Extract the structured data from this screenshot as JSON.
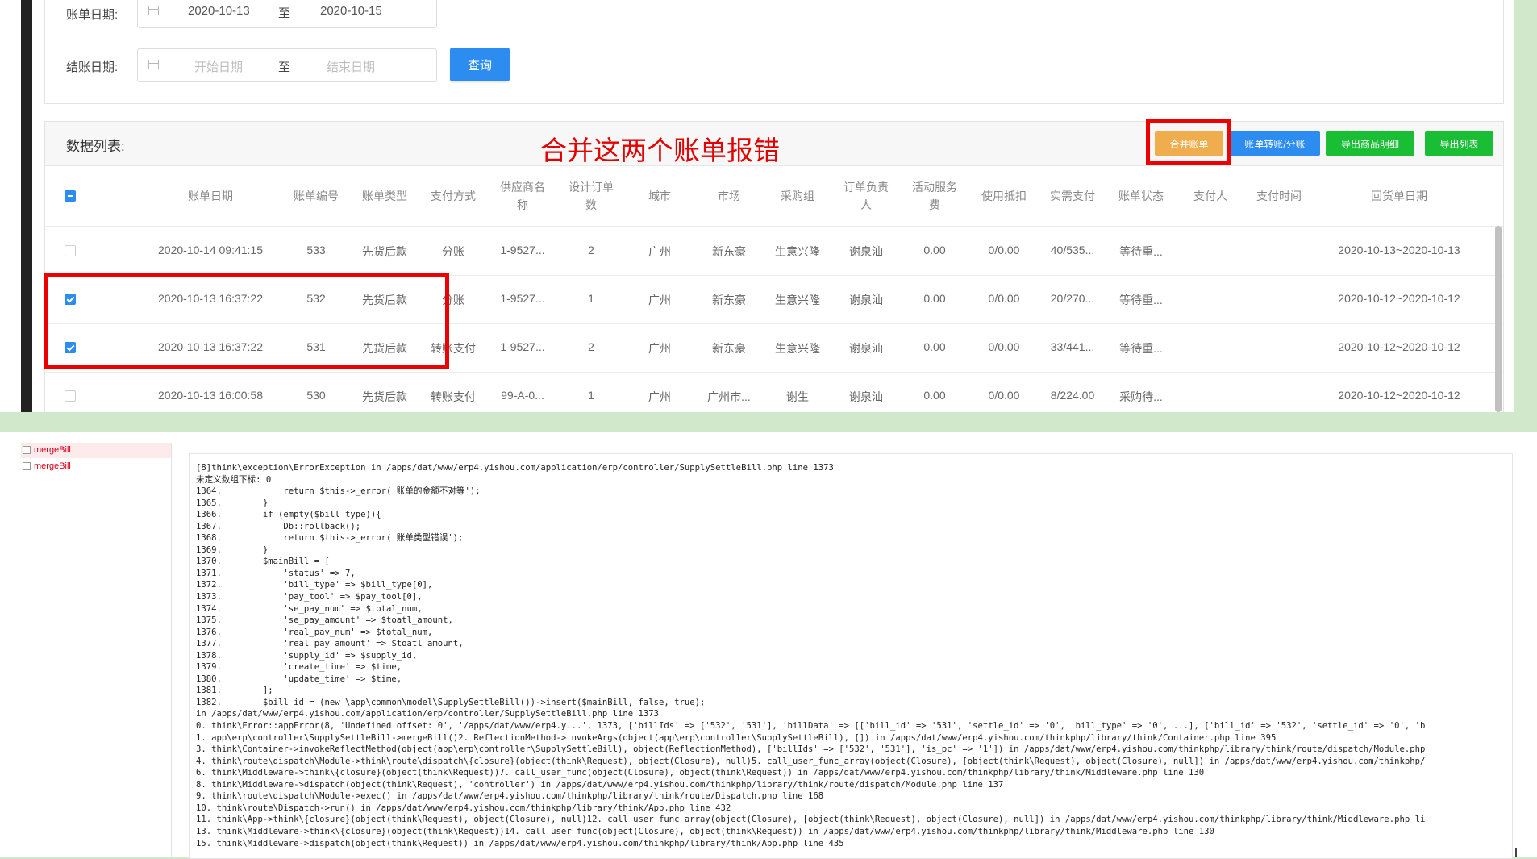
{
  "filters": {
    "bill_date_label": "账单日期:",
    "bill_date_start": "2020-10-13",
    "bill_date_end": "2020-10-15",
    "settle_date_label": "结账日期:",
    "settle_start_placeholder": "开始日期",
    "settle_end_placeholder": "结束日期",
    "range_separator": "至",
    "query_button": "查询"
  },
  "list": {
    "title": "数据列表:",
    "annotation": "合并这两个账单报错",
    "buttons": {
      "merge": "合并账单",
      "transfer": "账单转账/分账",
      "export_detail": "导出商品明细",
      "export_list": "导出列表"
    }
  },
  "table": {
    "columns": [
      [
        "账单日期"
      ],
      [
        "账单编号"
      ],
      [
        "账单类型"
      ],
      [
        "支付方式"
      ],
      [
        "供应商名",
        "称"
      ],
      [
        "设计订单",
        "数"
      ],
      [
        "城市"
      ],
      [
        "市场"
      ],
      [
        "采购组"
      ],
      [
        "订单负责",
        "人"
      ],
      [
        "活动服务",
        "费"
      ],
      [
        "使用抵扣"
      ],
      [
        "实需支付"
      ],
      [
        "账单状态"
      ],
      [
        "支付人"
      ],
      [
        "支付时间"
      ],
      [
        "回货单日期"
      ]
    ],
    "rows": [
      {
        "checked": false,
        "cells": [
          "2020-10-14 09:41:15",
          "533",
          "先货后款",
          "分账",
          "1-9527...",
          "2",
          "广州",
          "新东豪",
          "生意兴隆",
          "谢泉汕",
          "0.00",
          "0/0.00",
          "40/535...",
          "等待重...",
          "",
          "",
          "2020-10-13~2020-10-13"
        ]
      },
      {
        "checked": true,
        "cells": [
          "2020-10-13 16:37:22",
          "532",
          "先货后款",
          "分账",
          "1-9527...",
          "1",
          "广州",
          "新东豪",
          "生意兴隆",
          "谢泉汕",
          "0.00",
          "0/0.00",
          "20/270...",
          "等待重...",
          "",
          "",
          "2020-10-12~2020-10-12"
        ]
      },
      {
        "checked": true,
        "cells": [
          "2020-10-13 16:37:22",
          "531",
          "先货后款",
          "转账支付",
          "1-9527...",
          "2",
          "广州",
          "新东豪",
          "生意兴隆",
          "谢泉汕",
          "0.00",
          "0/0.00",
          "33/441...",
          "等待重...",
          "",
          "",
          "2020-10-12~2020-10-12"
        ]
      },
      {
        "checked": false,
        "cells": [
          "2020-10-13 16:00:58",
          "530",
          "先货后款",
          "转账支付",
          "99-A-0...",
          "1",
          "广州",
          "广州市...",
          "谢生",
          "谢泉汕",
          "0.00",
          "0/0.00",
          "8/224.00",
          "采购待...",
          "",
          "",
          "2020-10-12~2020-10-12"
        ]
      }
    ]
  },
  "debug": {
    "sidebar_items": [
      "mergeBill",
      "mergeBill"
    ],
    "error_lines": [
      "[8]think\\exception\\ErrorException in /apps/dat/www/erp4.yishou.com/application/erp/controller/SupplySettleBill.php line 1373",
      "未定义数组下标: 0",
      "1364.            return $this->_error('账单的金额不对等');",
      "1365.        }",
      "1366.        if (empty($bill_type)){",
      "1367.            Db::rollback();",
      "1368.            return $this->_error('账单类型错误');",
      "1369.        }",
      "1370.        $mainBill = [",
      "1371.            'status' => 7,",
      "1372.            'bill_type' => $bill_type[0],",
      "1373.            'pay_tool' => $pay_tool[0],",
      "1374.            'se_pay_num' => $total_num,",
      "1375.            'se_pay_amount' => $toatl_amount,",
      "1376.            'real_pay_num' => $total_num,",
      "1377.            'real_pay_amount' => $toatl_amount,",
      "1378.            'supply_id' => $supply_id,",
      "1379.            'create_time' => $time,",
      "1380.            'update_time' => $time,",
      "1381.        ];",
      "1382.        $bill_id = (new \\app\\common\\model\\SupplySettleBill())->insert($mainBill, false, true);",
      "in /apps/dat/www/erp4.yishou.com/application/erp/controller/SupplySettleBill.php line 1373",
      "0. think\\Error::appError(8, 'Undefined offset: 0', '/apps/dat/www/erp4.y...', 1373, ['billIds' => ['532', '531'], 'billData' => [['bill_id' => '531', 'settle_id' => '0', 'bill_type' => '0', ...], ['bill_id' => '532', 'settle_id' => '0', 'b",
      "1. app\\erp\\controller\\SupplySettleBill->mergeBill()2. ReflectionMethod->invokeArgs(object(app\\erp\\controller\\SupplySettleBill), []) in /apps/dat/www/erp4.yishou.com/thinkphp/library/think/Container.php line 395",
      "3. think\\Container->invokeReflectMethod(object(app\\erp\\controller\\SupplySettleBill), object(ReflectionMethod), ['billIds' => ['532', '531'], 'is_pc' => '1']) in /apps/dat/www/erp4.yishou.com/thinkphp/library/think/route/dispatch/Module.php",
      "4. think\\route\\dispatch\\Module->think\\route\\dispatch\\{closure}(object(think\\Request), object(Closure), null)5. call_user_func_array(object(Closure), [object(think\\Request), object(Closure), null]) in /apps/dat/www/erp4.yishou.com/thinkphp/",
      "6. think\\Middleware->think\\{closure}(object(think\\Request))7. call_user_func(object(Closure), object(think\\Request)) in /apps/dat/www/erp4.yishou.com/thinkphp/library/think/Middleware.php line 130",
      "8. think\\Middleware->dispatch(object(think\\Request), 'controller') in /apps/dat/www/erp4.yishou.com/thinkphp/library/think/route/dispatch/Module.php line 137",
      "9. think\\route\\dispatch\\Module->exec() in /apps/dat/www/erp4.yishou.com/thinkphp/library/think/route/Dispatch.php line 168",
      "10. think\\route\\Dispatch->run() in /apps/dat/www/erp4.yishou.com/thinkphp/library/think/App.php line 432",
      "11. think\\App->think\\{closure}(object(think\\Request), object(Closure), null)12. call_user_func_array(object(Closure), [object(think\\Request), object(Closure), null]) in /apps/dat/www/erp4.yishou.com/thinkphp/library/think/Middleware.php li",
      "13. think\\Middleware->think\\{closure}(object(think\\Request))14. call_user_func(object(Closure), object(think\\Request)) in /apps/dat/www/erp4.yishou.com/thinkphp/library/think/Middleware.php line 130",
      "15. think\\Middleware->dispatch(object(think\\Request)) in /apps/dat/www/erp4.yishou.com/thinkphp/library/think/App.php line 435"
    ]
  },
  "colors": {
    "primary": "#2d8cf0",
    "warning": "#f0ad4e",
    "success": "#19be35",
    "annotation_red": "#e30000",
    "background_green": "#d2e8cb"
  },
  "icons": [
    "calendar-icon",
    "checkbox-icon"
  ]
}
